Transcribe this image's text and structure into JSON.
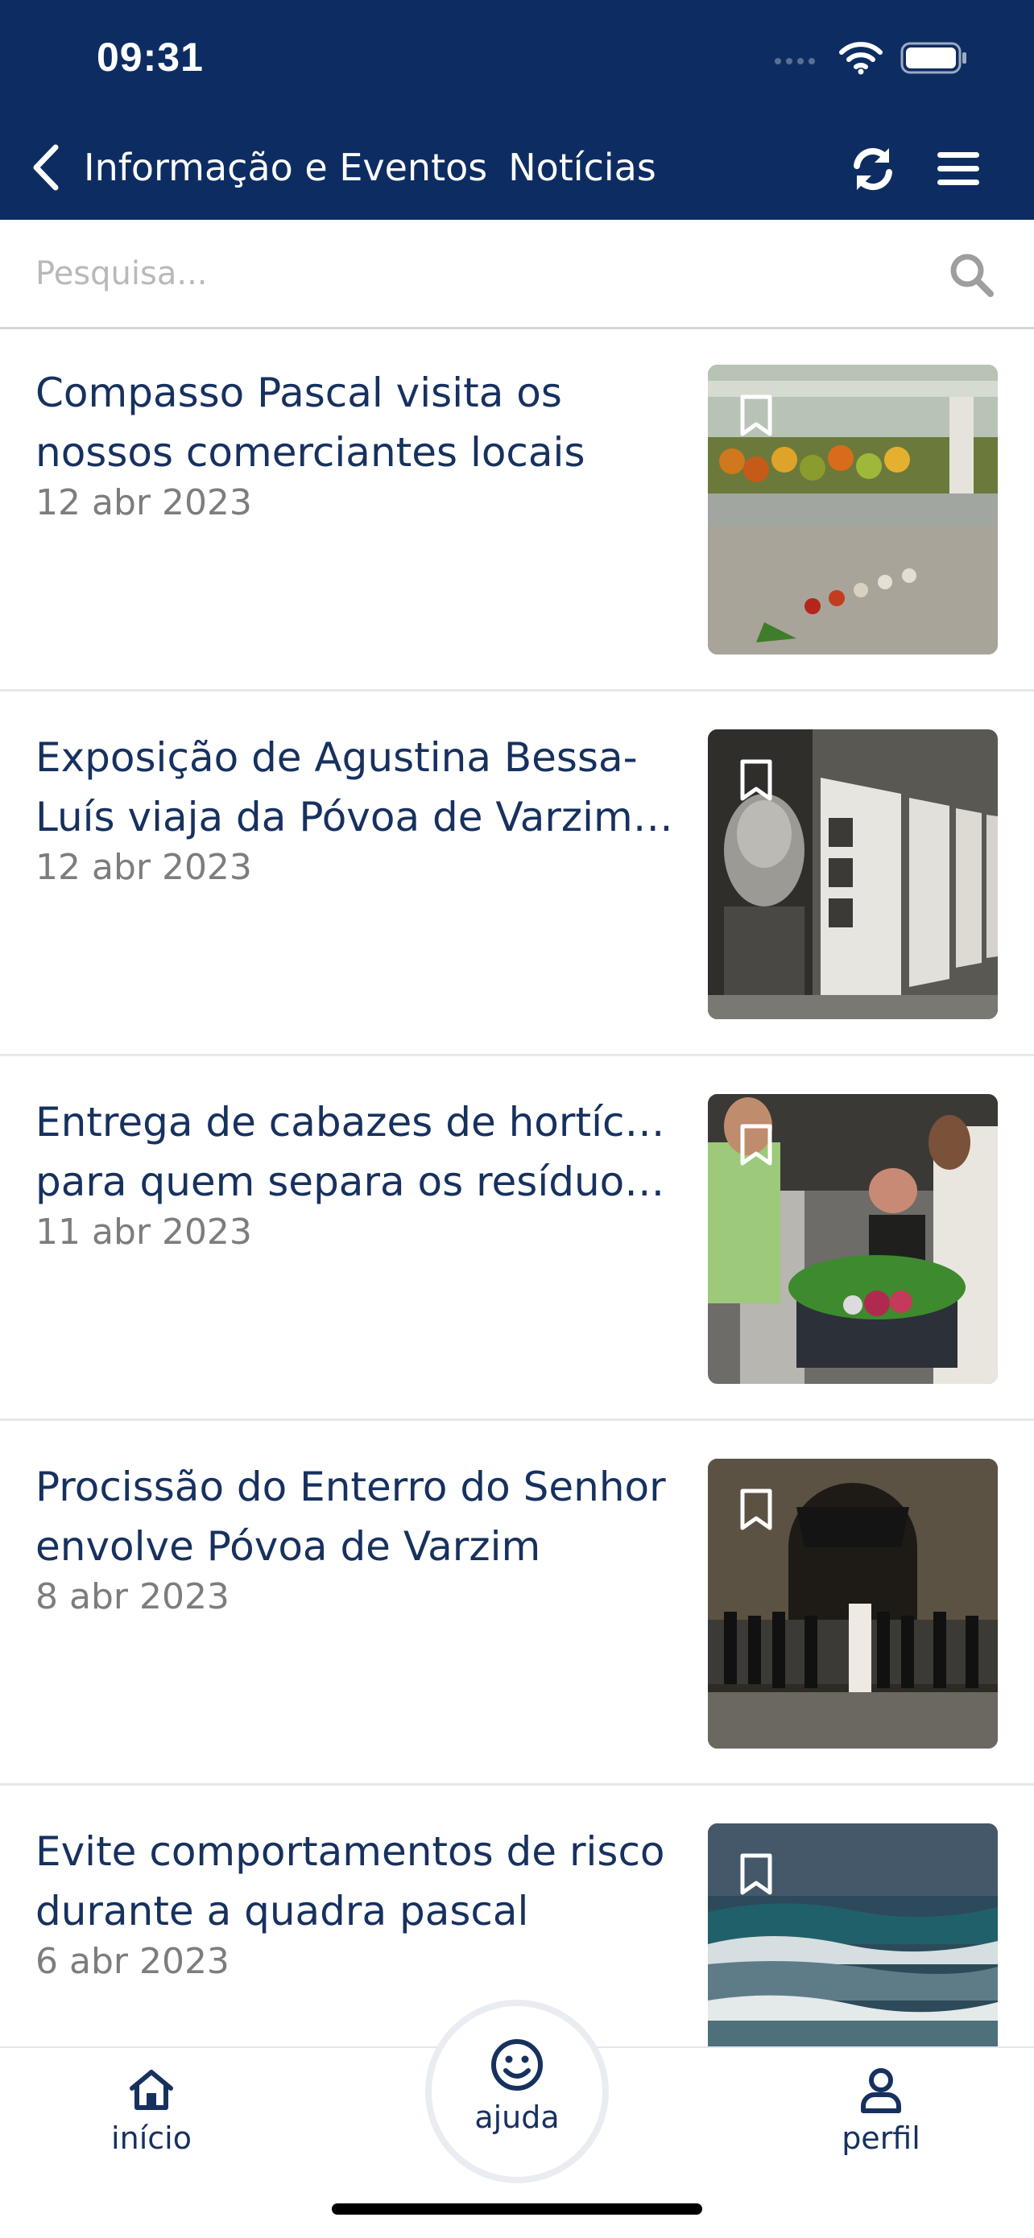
{
  "status_bar": {
    "time": "09:31",
    "icons": [
      "cellular-signal-icon",
      "wifi-icon",
      "battery-icon"
    ]
  },
  "header": {
    "breadcrumb_parent": "Informação e Eventos",
    "breadcrumb_current": "Notícias",
    "background_color": "#0d2d62",
    "icons": [
      "back-chevron-icon",
      "refresh-icon",
      "hamburger-menu-icon"
    ]
  },
  "search": {
    "placeholder": "Pesquisa..."
  },
  "news": [
    {
      "title_line1": "Compasso Pascal visita os",
      "title_line2": "nossos comerciantes locais",
      "date": "12 abr 2023",
      "image_subject": "market produce stalls with flowers on floor"
    },
    {
      "title_line1": "Exposição de Agustina Bessa-",
      "title_line2": "Luís viaja da Póvoa de Varzim a...",
      "date": "12 abr 2023",
      "image_subject": "exhibition panels with black and white portrait"
    },
    {
      "title_line1": "Entrega de cabazes de hortícolas",
      "title_line2": "para quem separa os resíduos a...",
      "date": "11 abr 2023",
      "image_subject": "people handing over a crate of vegetables"
    },
    {
      "title_line1": "Procissão do Enterro do Senhor",
      "title_line2": "envolve Póvoa de Varzim",
      "date": "8 abr 2023",
      "image_subject": "procession at night in front of a church"
    },
    {
      "title_line1": "Evite comportamentos de risco",
      "title_line2": "durante a quadra pascal",
      "date": "6 abr 2023",
      "image_subject": "sea waves"
    }
  ],
  "tabbar": {
    "home_label": "início",
    "help_label": "ajuda",
    "profile_label": "perfil"
  },
  "colors": {
    "primary": "#0d2d62",
    "title_text": "#17315f",
    "date_text": "#7d7d7d"
  }
}
